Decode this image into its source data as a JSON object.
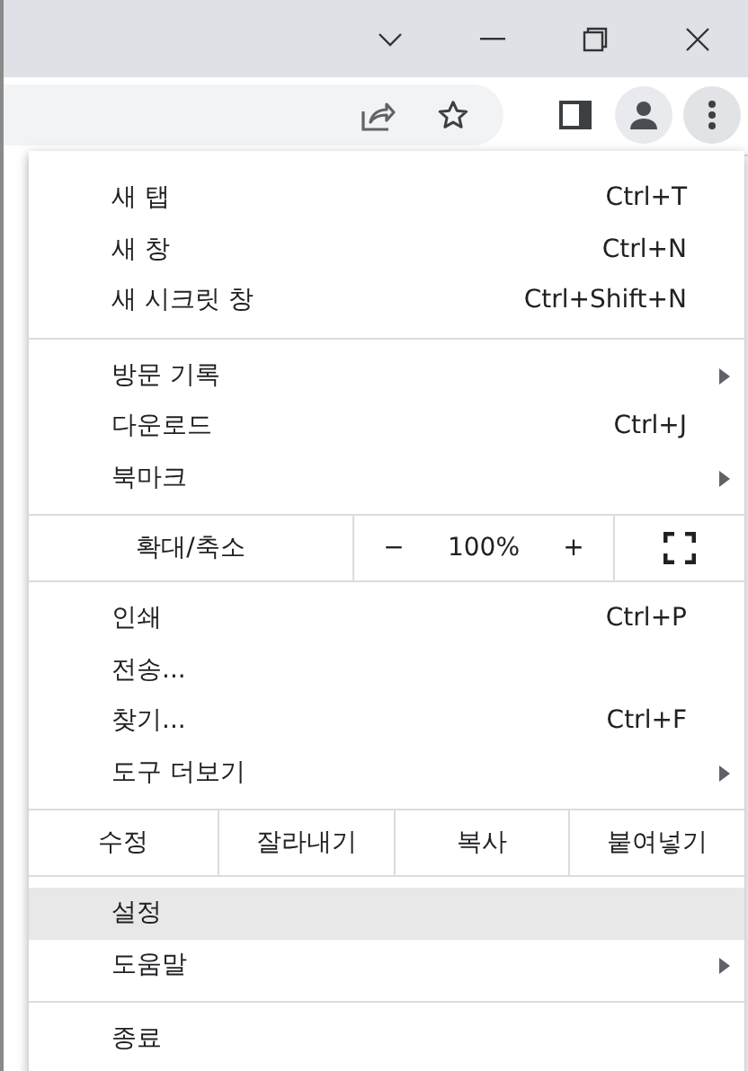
{
  "menu": {
    "sections": [
      {
        "kind": "items",
        "items": [
          {
            "label": "새 탭",
            "shortcut": "Ctrl+T",
            "submenu": false,
            "selected": false
          },
          {
            "label": "새 창",
            "shortcut": "Ctrl+N",
            "submenu": false,
            "selected": false
          },
          {
            "label": "새 시크릿 창",
            "shortcut": "Ctrl+Shift+N",
            "submenu": false,
            "selected": false
          }
        ]
      },
      {
        "kind": "items",
        "items": [
          {
            "label": "방문 기록",
            "submenu": true,
            "selected": false
          },
          {
            "label": "다운로드",
            "shortcut": "Ctrl+J",
            "submenu": false,
            "selected": false
          },
          {
            "label": "북마크",
            "submenu": true,
            "selected": false
          }
        ]
      },
      {
        "kind": "zoom",
        "label": "확대/축소",
        "minus": "−",
        "value": "100%",
        "plus": "+"
      },
      {
        "kind": "items",
        "items": [
          {
            "label": "인쇄",
            "shortcut": "Ctrl+P",
            "submenu": false,
            "selected": false
          },
          {
            "label": "전송...",
            "submenu": false,
            "selected": false
          },
          {
            "label": "찾기...",
            "shortcut": "Ctrl+F",
            "submenu": false,
            "selected": false
          },
          {
            "label": "도구 더보기",
            "submenu": true,
            "selected": false
          }
        ]
      },
      {
        "kind": "edit",
        "label": "수정",
        "buttons": [
          "잘라내기",
          "복사",
          "붙여넣기"
        ]
      },
      {
        "kind": "items",
        "items": [
          {
            "label": "설정",
            "submenu": false,
            "selected": true
          },
          {
            "label": "도움말",
            "submenu": true,
            "selected": false
          }
        ]
      },
      {
        "kind": "items",
        "items": [
          {
            "label": "종료",
            "submenu": false,
            "selected": false
          }
        ]
      }
    ]
  }
}
